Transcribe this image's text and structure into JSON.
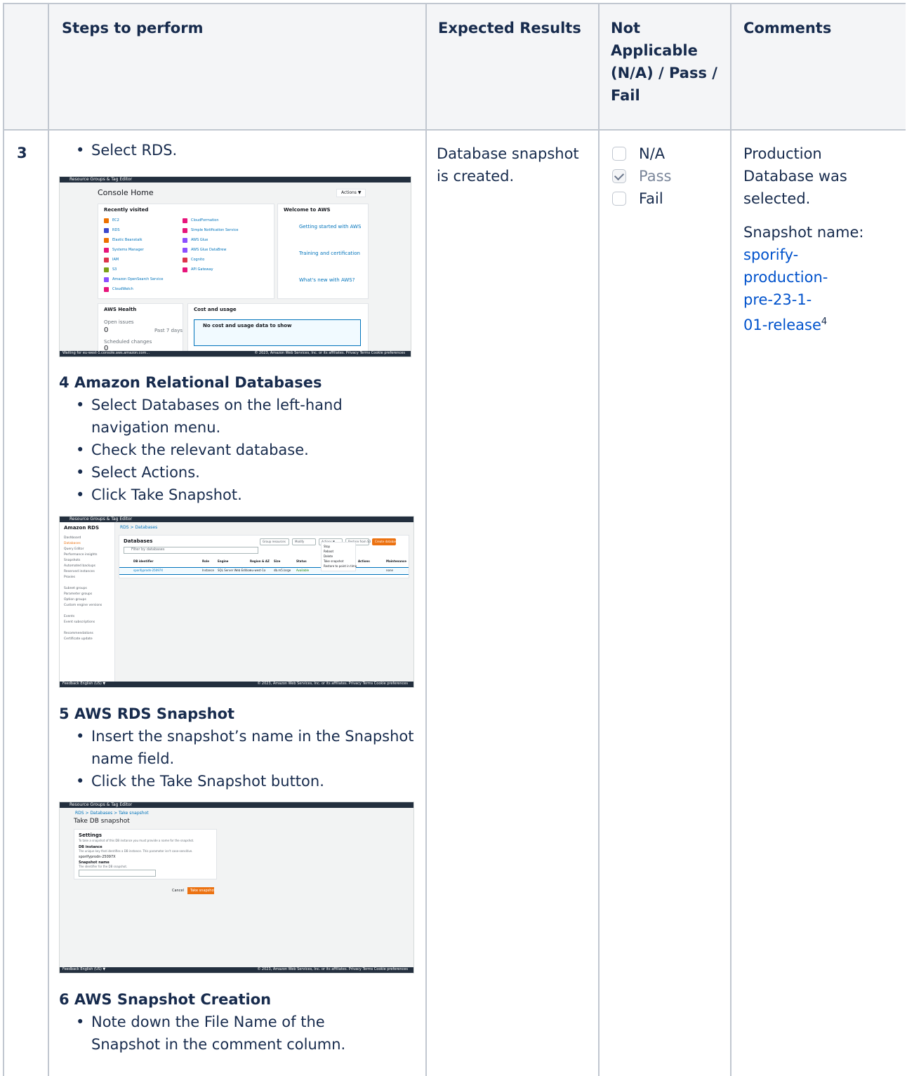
{
  "headers": {
    "steps": "Steps to perform",
    "expected": "Expected Results",
    "status": "Not Applicable (N/A) / Pass / Fail",
    "comments": "Comments"
  },
  "row": {
    "number": "3",
    "first_step": "Select RDS.",
    "sections": [
      {
        "title": "4 Amazon Relational Databases",
        "items": [
          "Select Databases on the left-hand navigation menu.",
          "Check the relevant database.",
          "Select Actions.",
          "Click Take Snapshot."
        ]
      },
      {
        "title": "5 AWS RDS Snapshot",
        "items": [
          "Insert the snapshot’s name in the Snapshot name field.",
          "Click the Take Snapshot button."
        ]
      },
      {
        "title": "6 AWS Snapshot Creation",
        "items": [
          "Note down the File Name of the Snapshot in the comment column."
        ]
      }
    ],
    "expected": "Database snapshot is created.",
    "status_options": [
      {
        "label": "N/A",
        "checked": false
      },
      {
        "label": "Pass",
        "checked": true
      },
      {
        "label": "Fail",
        "checked": false
      }
    ],
    "comment_1": "Production Database was selected.",
    "comment_2_label": "Snapshot name:",
    "comment_2_link": "sporify-production-pre-23-1-01-release",
    "comment_2_footnote": "4"
  },
  "screenshot1": {
    "topbar": "Resource Groups & Tag Editor",
    "title": "Console Home",
    "info": "Info",
    "actions": "Actions ▼",
    "recently_visited": "Recently visited",
    "services_left": [
      "EC2",
      "RDS",
      "Elastic Beanstalk",
      "Systems Manager",
      "IAM",
      "S3",
      "Amazon OpenSearch Service",
      "CloudWatch"
    ],
    "services_right": [
      "CloudFormation",
      "Simple Notification Service",
      "AWS Glue",
      "AWS Glue DataBrew",
      "Cognito",
      "API Gateway"
    ],
    "welcome": "Welcome to AWS",
    "welcome_items": [
      "Getting started with AWS",
      "Training and certification",
      "What's new with AWS?"
    ],
    "health": "AWS Health",
    "open_issues": "Open issues",
    "open_issues_val": "0",
    "past_days": "Past 7 days",
    "scheduled": "Scheduled changes",
    "scheduled_val": "0",
    "cost": "Cost and usage",
    "cost_msg": "No cost and usage data to show",
    "status_text": "Waiting for eu-west-1.console.aws.amazon.com...",
    "footer": "© 2023, Amazon Web Services, Inc. or its affiliates.   Privacy   Terms   Cookie preferences"
  },
  "screenshot2": {
    "topbar": "Resource Groups & Tag Editor",
    "sidebar_title": "Amazon RDS",
    "breadcrumb": "RDS  >  Databases",
    "nav": [
      "Dashboard",
      "Databases",
      "Query Editor",
      "Performance insights",
      "Snapshots",
      "Automated backups",
      "Reserved instances",
      "Proxies",
      "",
      "Subnet groups",
      "Parameter groups",
      "Option groups",
      "Custom engine versions",
      "",
      "Events",
      "Event subscriptions",
      "",
      "Recommendations",
      "Certificate update"
    ],
    "heading": "Databases",
    "filter": "Filter by databases",
    "columns": [
      "DB identifier",
      "Role",
      "Engine",
      "Region & AZ",
      "Size",
      "Status",
      "Actions",
      "Maintenance"
    ],
    "db_row": [
      "sporifyprodn-25097X",
      "Instance",
      "SQL Server Web Edition",
      "eu-west-1a",
      "db.m5.large",
      "Available",
      "",
      "none"
    ],
    "buttons": [
      "Group resources",
      "Modify",
      "Actions ▼",
      "Restore from S3",
      "Create database"
    ],
    "menu": [
      "Stop",
      "Reboot",
      "Delete",
      "Take snapshot",
      "Restore to point in time"
    ],
    "footer_left": "Feedback   English (US) ▼",
    "footer": "© 2023, Amazon Web Services, Inc. or its affiliates.   Privacy   Terms   Cookie preferences"
  },
  "screenshot3": {
    "topbar": "Resource Groups & Tag Editor",
    "breadcrumb": "RDS  >  Databases  >  Take snapshot",
    "title": "Take DB snapshot",
    "settings": "Settings",
    "settings_desc": "To take a snapshot of this DB instance you must provide a name for the snapshot.",
    "db_instance": "DB instance",
    "db_instance_desc": "The unique key that identifies a DB instance. This parameter isn't case-sensitive.",
    "db_instance_val": "sporifyprodn-25097X",
    "snapshot_name": "Snapshot name",
    "snapshot_name_desc": "The identifier for the DB snapshot.",
    "cancel": "Cancel",
    "take": "Take snapshot",
    "footer_left": "Feedback   English (US) ▼",
    "footer": "© 2023, Amazon Web Services, Inc. or its affiliates.   Privacy   Terms   Cookie preferences"
  }
}
